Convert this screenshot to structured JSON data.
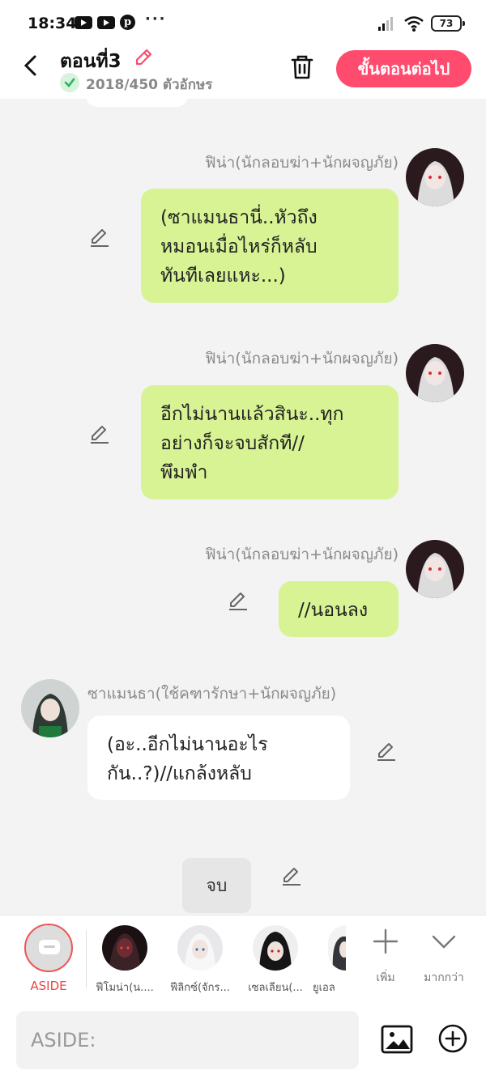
{
  "status": {
    "time": "18:34",
    "battery": "73"
  },
  "header": {
    "title": "ตอนที่3",
    "char_count": "2018/450 ตัวอักษร",
    "next_label": "ขั้นตอนต่อไป"
  },
  "messages": [
    {
      "sender": "ฟิน่า(นักลอบฆ่า+นักผจญภัย)",
      "text": "(ซาแมนธานี่..หัวถึง\nหมอนเมื่อไหร่ก็หลับ\nทันทีเลยแหะ...)"
    },
    {
      "sender": "ฟิน่า(นักลอบฆ่า+นักผจญภัย)",
      "text": "อีกไม่นานแล้วสินะ..ทุก\nอย่างก็จะจบสักที//\nพึมพำ"
    },
    {
      "sender": "ฟิน่า(นักลอบฆ่า+นักผจญภัย)",
      "text": "//นอนลง"
    },
    {
      "sender": "ซาแมนธา(ใช้คฑารักษา+นักผจญภัย)",
      "text": "(อะ..อีกไม่นานอะไร\nกัน..?)//แกล้งหลับ"
    }
  ],
  "end_chip": "จบ",
  "characters": {
    "aside_label": "ASIDE",
    "items": [
      {
        "label": "ฟีโมน่า(น...."
      },
      {
        "label": "ฟีลิกซ์(จักร..."
      },
      {
        "label": "เซลเลียน(..."
      },
      {
        "label": "ยูเอล"
      }
    ],
    "add_label": "เพิ่ม",
    "more_label": "มากกว่า"
  },
  "input": {
    "placeholder": "ASIDE:"
  },
  "colors": {
    "accent": "#ff4b6e",
    "green_bubble": "#d7f394"
  }
}
